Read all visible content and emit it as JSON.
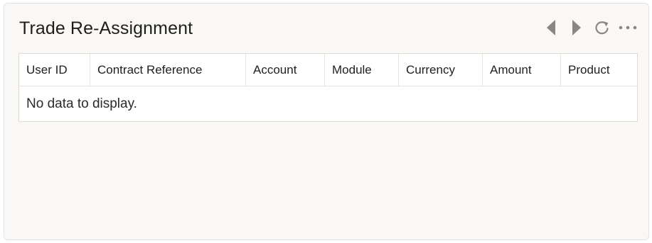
{
  "widget": {
    "title": "Trade Re-Assignment",
    "toolbar": {
      "previous_icon": "caret-left-icon",
      "next_icon": "caret-right-icon",
      "refresh_icon": "refresh-icon",
      "more_icon": "more-horizontal-icon"
    }
  },
  "table": {
    "columns": [
      "User ID",
      "Contract Reference",
      "Account",
      "Module",
      "Currency",
      "Amount",
      "Product"
    ],
    "rows": [],
    "empty_message": "No data to display."
  },
  "colors": {
    "card_background": "#f9f8f6",
    "icon": "#8a8781",
    "text": "#1f1e1c"
  }
}
